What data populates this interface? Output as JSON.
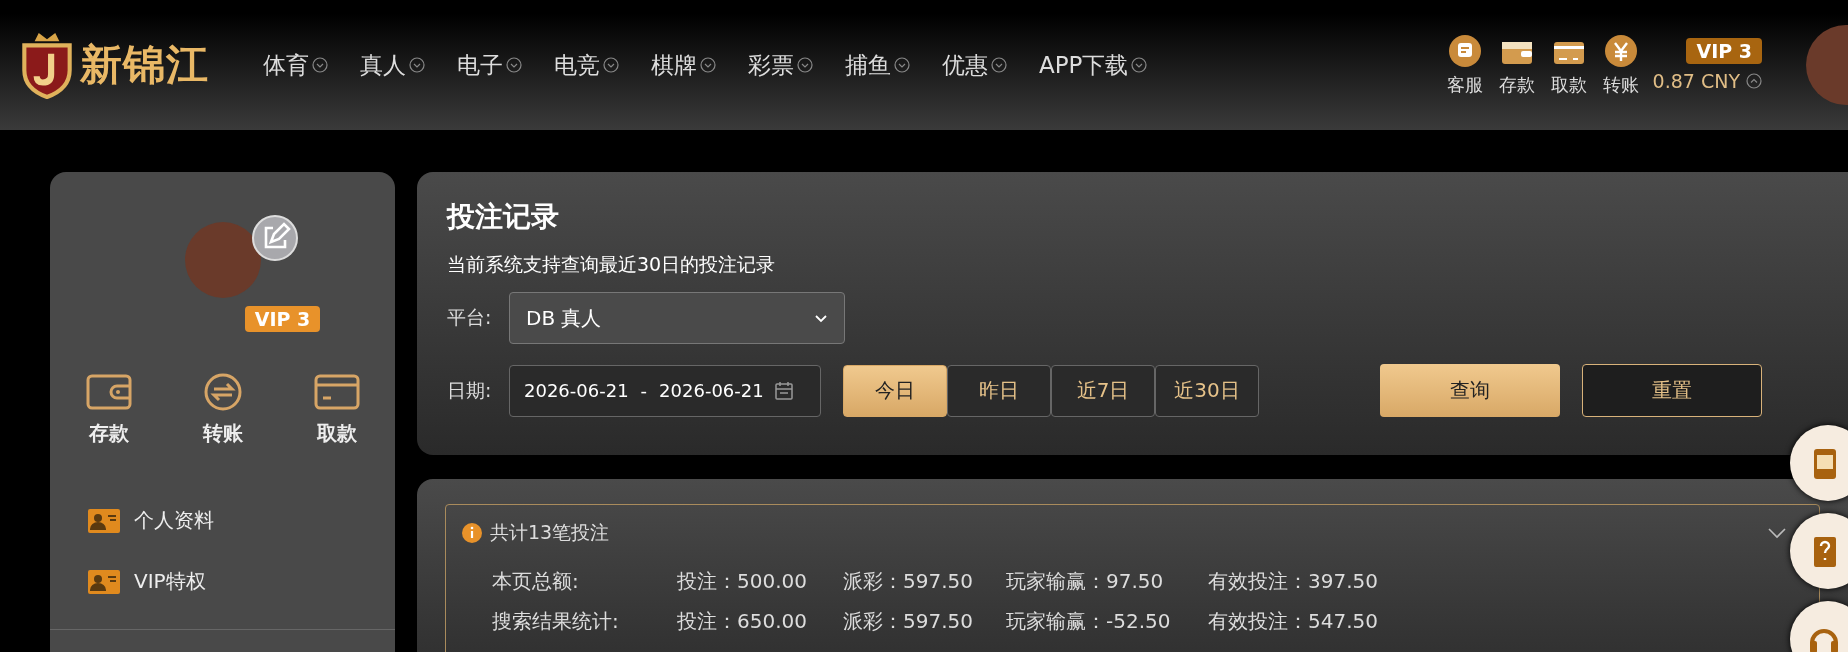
{
  "header": {
    "logo_text": "新锦江",
    "nav": [
      {
        "label": "体育"
      },
      {
        "label": "真人"
      },
      {
        "label": "电子"
      },
      {
        "label": "电竞"
      },
      {
        "label": "棋牌"
      },
      {
        "label": "彩票"
      },
      {
        "label": "捕鱼"
      },
      {
        "label": "优惠"
      },
      {
        "label": "APP下载"
      }
    ],
    "actions": [
      {
        "label": "客服",
        "kind": "chat"
      },
      {
        "label": "存款",
        "kind": "wallet"
      },
      {
        "label": "取款",
        "kind": "card"
      },
      {
        "label": "转账",
        "kind": "yuan"
      }
    ],
    "vip": "VIP 3",
    "balance": "0.87 CNY"
  },
  "sidebar": {
    "vip": "VIP 3",
    "quick_actions": [
      {
        "label": "存款",
        "kind": "wallet"
      },
      {
        "label": "转账",
        "kind": "transfer"
      },
      {
        "label": "取款",
        "kind": "card"
      }
    ],
    "menu": [
      {
        "label": "个人资料"
      },
      {
        "label": "VIP特权"
      }
    ]
  },
  "query": {
    "title": "投注记录",
    "notice": "当前系统支持查询最近30日的投注记录",
    "platform": {
      "label": "平台:",
      "value": "DB 真人"
    },
    "date": {
      "label": "日期:",
      "start": "2026-06-21",
      "separator": "-",
      "end": "2026-06-21"
    },
    "ranges": [
      {
        "label": "今日",
        "selected": true
      },
      {
        "label": "昨日",
        "selected": false
      },
      {
        "label": "近7日",
        "selected": false
      },
      {
        "label": "近30日",
        "selected": false
      }
    ],
    "buttons": [
      {
        "label": "查询",
        "kind": "primary"
      },
      {
        "label": "重置",
        "kind": "outline"
      }
    ]
  },
  "summary": {
    "count": "共计13笔投注",
    "expanded": true,
    "rows": [
      {
        "label": "本页总额:",
        "cells": [
          "投注：500.00",
          "派彩：597.50",
          "玩家输赢：97.50",
          "有效投注：397.50"
        ]
      },
      {
        "label": "搜索结果统计:",
        "cells": [
          "投注：650.00",
          "派彩：597.50",
          "玩家输赢：-52.50",
          "有效投注：547.50"
        ]
      }
    ]
  },
  "floating": [
    {
      "kind": "app"
    },
    {
      "kind": "help"
    },
    {
      "kind": "support"
    }
  ]
}
